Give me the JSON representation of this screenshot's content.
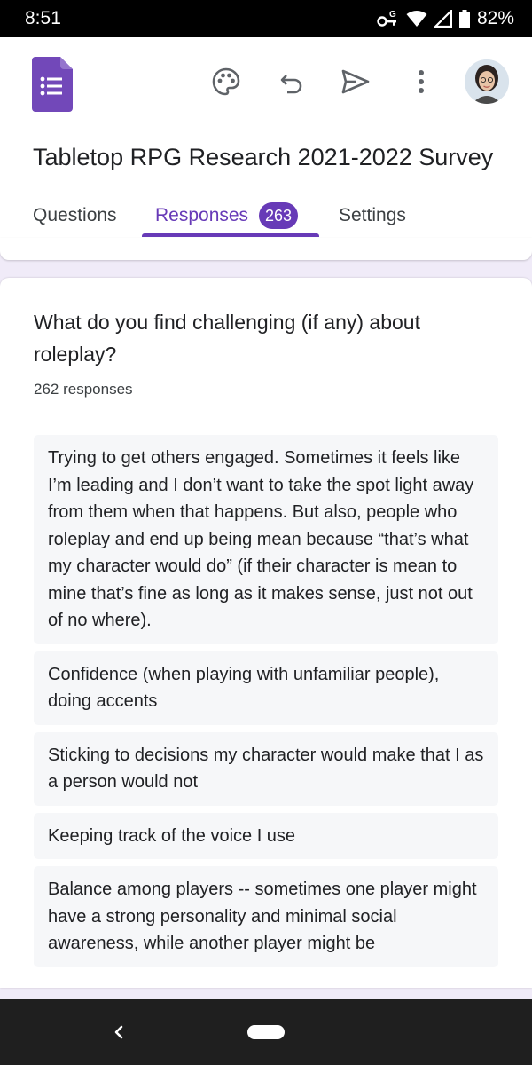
{
  "status_bar": {
    "time": "8:51",
    "battery": "82%"
  },
  "header": {
    "form_title": "Tabletop RPG Research 2021-2022 Survey",
    "toolbar": {
      "palette_icon": "palette-icon",
      "undo_icon": "undo-icon",
      "send_icon": "send-icon",
      "more_icon": "more-vert-icon",
      "avatar": "avatar"
    }
  },
  "tabs": [
    {
      "label": "Questions"
    },
    {
      "label": "Responses",
      "badge": "263",
      "active": true
    },
    {
      "label": "Settings"
    }
  ],
  "question": {
    "title": "What do you find challenging (if any) about roleplay?",
    "response_count": "262 responses",
    "responses": [
      "Trying to get others engaged. Sometimes it feels like I’m leading and I don’t want to take the spot light away from them when that happens. But also, people who roleplay and end up being mean because “that’s what my character would do” (if their character is mean to mine that’s fine as long as it makes sense, just not out of no where).",
      "Confidence (when playing with unfamiliar people), doing accents",
      "Sticking to decisions my character would make that I as a person would not",
      "Keeping track of the voice I use",
      "Balance among players -- sometimes one player might have a strong personality and minimal social awareness, while another player might be"
    ]
  },
  "colors": {
    "accent": "#673ab7",
    "background": "#f0ebf8",
    "response_bg": "#f6f7f9"
  }
}
